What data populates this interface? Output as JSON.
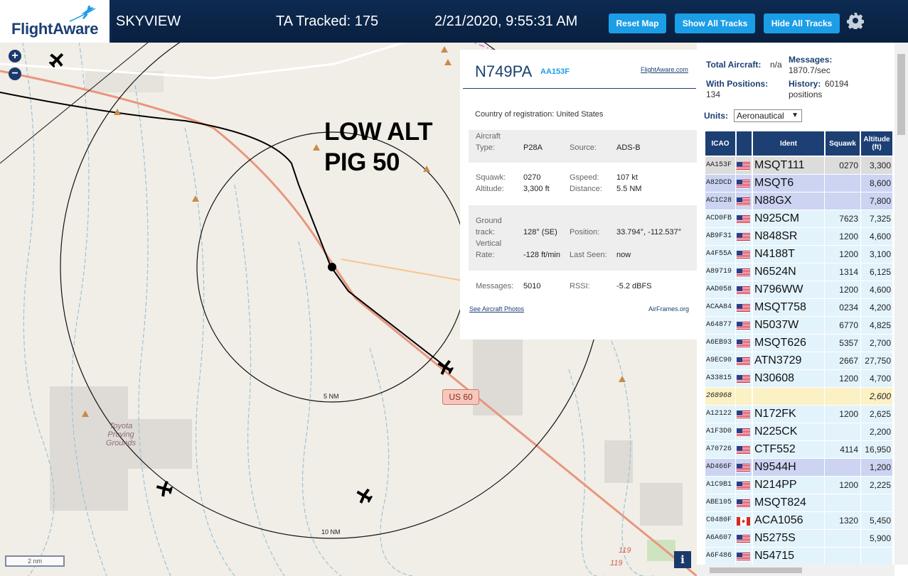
{
  "header": {
    "logo_text": "FlightAware",
    "title": "SKYVIEW",
    "tracked": "TA Tracked: 175",
    "datetime": "2/21/2020, 9:55:31 AM",
    "buttons": {
      "reset_map": "Reset Map",
      "show_all": "Show All Tracks",
      "hide_all": "Hide All Tracks"
    }
  },
  "map": {
    "overlay_line1": "LOW ALT",
    "overlay_line2": "PIG 50",
    "road_shield": "US 60",
    "ring_inner": "5 NM",
    "ring_outer": "10 NM",
    "place_label": "Toyota Proving Grounds",
    "scale": "2 nm",
    "info": "i",
    "zoom_in": "+",
    "zoom_out": "−",
    "route_marker_a": "119",
    "route_marker_b": "119"
  },
  "detail": {
    "callsign": "N749PA",
    "hex": "AA153F",
    "link": "FlightAware.com",
    "country_label": "Country of registration:",
    "country": "United States",
    "aircraft_label": "Aircraft",
    "type_label": "Type:",
    "type": "P28A",
    "source_label": "Source:",
    "source": "ADS-B",
    "squawk_label": "Squawk:",
    "squawk": "0270",
    "gspeed_label": "Gspeed:",
    "gspeed": "107 kt",
    "altitude_label": "Altitude:",
    "altitude": "3,300 ft",
    "distance_label": "Distance:",
    "distance": "5.5 NM",
    "ground_label": "Ground",
    "track_label": "track:",
    "track": "128° (SE)",
    "position_label": "Position:",
    "position": "33.794°, -112.537°",
    "vertical_label": "Vertical",
    "rate_label": "Rate:",
    "rate": "-128 ft/min",
    "lastseen_label": "Last Seen:",
    "lastseen": "now",
    "messages_label": "Messages:",
    "messages": "5010",
    "rssi_label": "RSSI:",
    "rssi": "-5.2 dBFS",
    "photos_link": "See Aircraft Photos",
    "airframes_link": "AirFrames.org"
  },
  "sidebar": {
    "total_label": "Total Aircraft:",
    "total": "n/a",
    "messages_label": "Messages:",
    "messages": "1870.7/sec",
    "positions_label": "With Positions:",
    "positions": "134",
    "history_label": "History:",
    "history": "60194",
    "history_unit": "positions",
    "units_label": "Units:",
    "units_value": "Aeronautical",
    "columns": {
      "icao": "ICAO",
      "ident": "Ident",
      "squawk": "Squawk",
      "altitude": "Altitude",
      "altitude_unit": "(ft)"
    },
    "rows": [
      {
        "icao": "AA153F",
        "flag": "us",
        "ident": "MSQT111",
        "squawk": "0270",
        "alt": "3,300",
        "bg": "#dcdcdc"
      },
      {
        "icao": "A82DCD",
        "flag": "us",
        "ident": "MSQT6",
        "squawk": "",
        "alt": "8,600",
        "bg": "#ccd4f2"
      },
      {
        "icao": "AC1C28",
        "flag": "us",
        "ident": "N88GX",
        "squawk": "",
        "alt": "7,800",
        "bg": "#ccd4f2"
      },
      {
        "icao": "ACD0FB",
        "flag": "us",
        "ident": "N925CM",
        "squawk": "7623",
        "alt": "7,325",
        "bg": "#e3f3fb"
      },
      {
        "icao": "AB9F31",
        "flag": "us",
        "ident": "N848SR",
        "squawk": "1200",
        "alt": "4,600",
        "bg": "#e3f3fb"
      },
      {
        "icao": "A4F55A",
        "flag": "us",
        "ident": "N4188T",
        "squawk": "1200",
        "alt": "3,100",
        "bg": "#e3f3fb"
      },
      {
        "icao": "A89719",
        "flag": "us",
        "ident": "N6524N",
        "squawk": "1314",
        "alt": "6,125",
        "bg": "#e3f3fb"
      },
      {
        "icao": "AAD058",
        "flag": "us",
        "ident": "N796WW",
        "squawk": "1200",
        "alt": "4,600",
        "bg": "#e3f3fb"
      },
      {
        "icao": "ACAA84",
        "flag": "us",
        "ident": "MSQT758",
        "squawk": "0234",
        "alt": "4,200",
        "bg": "#e3f3fb"
      },
      {
        "icao": "A64877",
        "flag": "us",
        "ident": "N5037W",
        "squawk": "6770",
        "alt": "4,825",
        "bg": "#e3f3fb"
      },
      {
        "icao": "A6EB93",
        "flag": "us",
        "ident": "MSQT626",
        "squawk": "5357",
        "alt": "2,700",
        "bg": "#e3f3fb"
      },
      {
        "icao": "A9EC90",
        "flag": "us",
        "ident": "ATN3729",
        "squawk": "2667",
        "alt": "27,750",
        "bg": "#e3f3fb"
      },
      {
        "icao": "A33815",
        "flag": "us",
        "ident": "N30608",
        "squawk": "1200",
        "alt": "4,700",
        "bg": "#e3f3fb"
      },
      {
        "icao": "268968",
        "flag": "",
        "ident": "",
        "squawk": "",
        "alt": "2,600",
        "bg": "#fbf1c4",
        "italic": true
      },
      {
        "icao": "A12122",
        "flag": "us",
        "ident": "N172FK",
        "squawk": "1200",
        "alt": "2,625",
        "bg": "#e3f3fb"
      },
      {
        "icao": "A1F3D0",
        "flag": "us",
        "ident": "N225CK",
        "squawk": "",
        "alt": "2,200",
        "bg": "#e3f3fb"
      },
      {
        "icao": "A70726",
        "flag": "us",
        "ident": "CTF552",
        "squawk": "4114",
        "alt": "16,950",
        "bg": "#e3f3fb"
      },
      {
        "icao": "AD466F",
        "flag": "us",
        "ident": "N9544H",
        "squawk": "",
        "alt": "1,200",
        "bg": "#ccd4f2"
      },
      {
        "icao": "A1C9B1",
        "flag": "us",
        "ident": "N214PP",
        "squawk": "1200",
        "alt": "2,225",
        "bg": "#e3f3fb"
      },
      {
        "icao": "ABE105",
        "flag": "us",
        "ident": "MSQT824",
        "squawk": "",
        "alt": "",
        "bg": "#e3f3fb"
      },
      {
        "icao": "C0480F",
        "flag": "ca",
        "ident": "ACA1056",
        "squawk": "1320",
        "alt": "5,450",
        "bg": "#e3f3fb"
      },
      {
        "icao": "A6A607",
        "flag": "us",
        "ident": "N5275S",
        "squawk": "",
        "alt": "5,900",
        "bg": "#e3f3fb"
      },
      {
        "icao": "A6F486",
        "flag": "us",
        "ident": "N54715",
        "squawk": "",
        "alt": "",
        "bg": "#e3f3fb"
      }
    ]
  },
  "colors": {
    "header_bg": "#0d2a52",
    "button_blue": "#1c9ee6",
    "table_header": "#1c3f74",
    "selected_row": "#dcdcdc",
    "highlight_row": "#ccd4f2",
    "row_bg": "#e3f3fb",
    "no_position_row": "#fbf1c4",
    "map_bg": "#f1eee7",
    "highway": "#e8967f"
  }
}
